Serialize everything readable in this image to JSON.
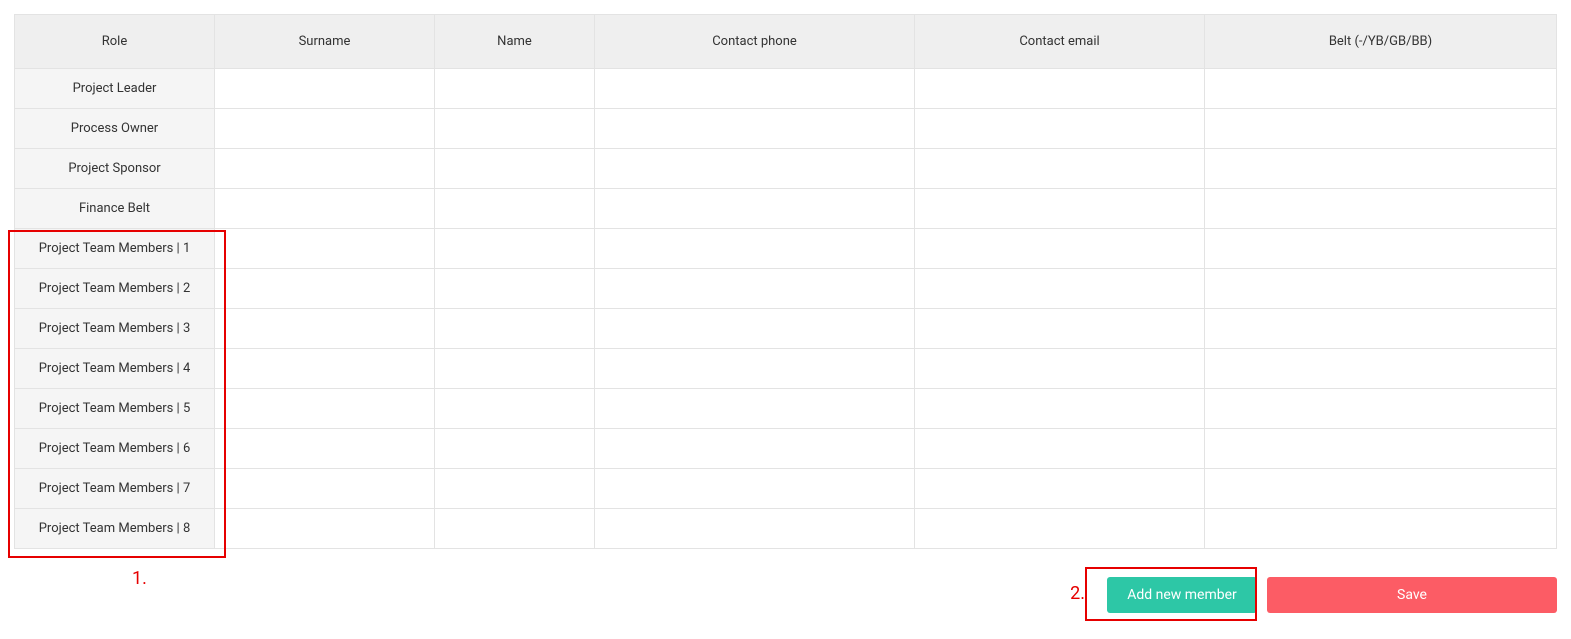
{
  "table": {
    "headers": {
      "role": "Role",
      "surname": "Surname",
      "name": "Name",
      "phone": "Contact phone",
      "email": "Contact email",
      "belt": "Belt (-/YB/GB/BB)"
    },
    "rows": [
      {
        "role": "Project Leader",
        "surname": "",
        "name": "",
        "phone": "",
        "email": "",
        "belt": ""
      },
      {
        "role": "Process Owner",
        "surname": "",
        "name": "",
        "phone": "",
        "email": "",
        "belt": ""
      },
      {
        "role": "Project Sponsor",
        "surname": "",
        "name": "",
        "phone": "",
        "email": "",
        "belt": ""
      },
      {
        "role": "Finance Belt",
        "surname": "",
        "name": "",
        "phone": "",
        "email": "",
        "belt": ""
      },
      {
        "role": "Project Team Members | 1",
        "surname": "",
        "name": "",
        "phone": "",
        "email": "",
        "belt": ""
      },
      {
        "role": "Project Team Members | 2",
        "surname": "",
        "name": "",
        "phone": "",
        "email": "",
        "belt": ""
      },
      {
        "role": "Project Team Members | 3",
        "surname": "",
        "name": "",
        "phone": "",
        "email": "",
        "belt": ""
      },
      {
        "role": "Project Team Members | 4",
        "surname": "",
        "name": "",
        "phone": "",
        "email": "",
        "belt": ""
      },
      {
        "role": "Project Team Members | 5",
        "surname": "",
        "name": "",
        "phone": "",
        "email": "",
        "belt": ""
      },
      {
        "role": "Project Team Members | 6",
        "surname": "",
        "name": "",
        "phone": "",
        "email": "",
        "belt": ""
      },
      {
        "role": "Project Team Members | 7",
        "surname": "",
        "name": "",
        "phone": "",
        "email": "",
        "belt": ""
      },
      {
        "role": "Project Team Members | 8",
        "surname": "",
        "name": "",
        "phone": "",
        "email": "",
        "belt": ""
      }
    ]
  },
  "footer": {
    "add_label": "Add new member",
    "save_label": "Save"
  },
  "annotations": {
    "label1": "1.",
    "label2": "2."
  },
  "colors": {
    "add_btn": "#2dc7a6",
    "save_btn": "#fc5c65",
    "annot": "#e60000"
  }
}
